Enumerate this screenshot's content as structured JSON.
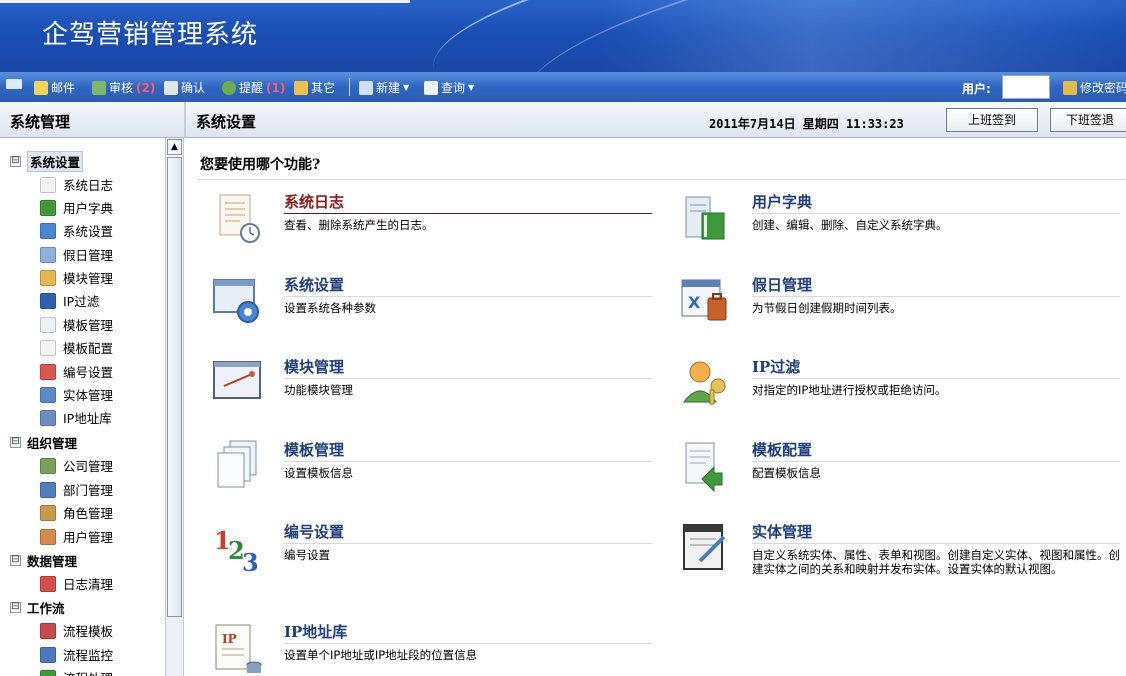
{
  "app": {
    "title": "企驾营销管理系统"
  },
  "toolbar": {
    "mail": "邮件",
    "review": "审核",
    "review_count": "(2)",
    "confirm": "确认",
    "remind": "提醒",
    "remind_count": "(1)",
    "other": "其它",
    "new": "新建",
    "query": "查询",
    "user_label": "用户:",
    "change_password": "修改密码"
  },
  "header": {
    "left_title": "系统管理",
    "main_title": "系统设置",
    "datetime": "2011年7月14日 星期四 11:33:23",
    "checkin": "上班签到",
    "checkout": "下班签退"
  },
  "sidebar": {
    "groups": [
      {
        "label": "系统设置",
        "expanded": "⊟",
        "items": [
          "系统日志",
          "用户字典",
          "系统设置",
          "假日管理",
          "模块管理",
          "IP过滤",
          "模板管理",
          "模板配置",
          "编号设置",
          "实体管理",
          "IP地址库"
        ]
      },
      {
        "label": "组织管理",
        "expanded": "⊟",
        "items": [
          "公司管理",
          "部门管理",
          "角色管理",
          "用户管理"
        ]
      },
      {
        "label": "数据管理",
        "expanded": "⊟",
        "items": [
          "日志清理"
        ]
      },
      {
        "label": "工作流",
        "expanded": "⊟",
        "items": [
          "流程模板",
          "流程监控",
          "流程处理"
        ]
      }
    ]
  },
  "main": {
    "question": "您要使用哪个功能?",
    "functions": [
      {
        "title": "系统日志",
        "desc": "查看、删除系统产生的日志。",
        "icon": "log-doc-icon"
      },
      {
        "title": "用户字典",
        "desc": "创建、编辑、删除、自定义系统字典。",
        "icon": "dictionary-icon"
      },
      {
        "title": "系统设置",
        "desc": "设置系统各种参数",
        "icon": "settings-gear-icon"
      },
      {
        "title": "假日管理",
        "desc": "为节假日创建假期时间列表。",
        "icon": "holiday-calendar-icon"
      },
      {
        "title": "模块管理",
        "desc": "功能模块管理",
        "icon": "module-window-icon"
      },
      {
        "title": "IP过滤",
        "desc": "对指定的IP地址进行授权或拒绝访问。",
        "icon": "user-key-icon"
      },
      {
        "title": "模板管理",
        "desc": "设置模板信息",
        "icon": "template-pages-icon"
      },
      {
        "title": "模板配置",
        "desc": "配置模板信息",
        "icon": "template-config-icon"
      },
      {
        "title": "编号设置",
        "desc": "编号设置",
        "icon": "numbering-123-icon"
      },
      {
        "title": "实体管理",
        "desc": "自定义系统实体、属性、表单和视图。创建自定义实体、视图和属性。创建实体之间的关系和映射并发布实体。设置实体的默认视图。",
        "icon": "entity-edit-icon"
      },
      {
        "title": "IP地址库",
        "desc": "设置单个IP地址或IP地址段的位置信息",
        "icon": "ip-database-icon"
      }
    ]
  }
}
